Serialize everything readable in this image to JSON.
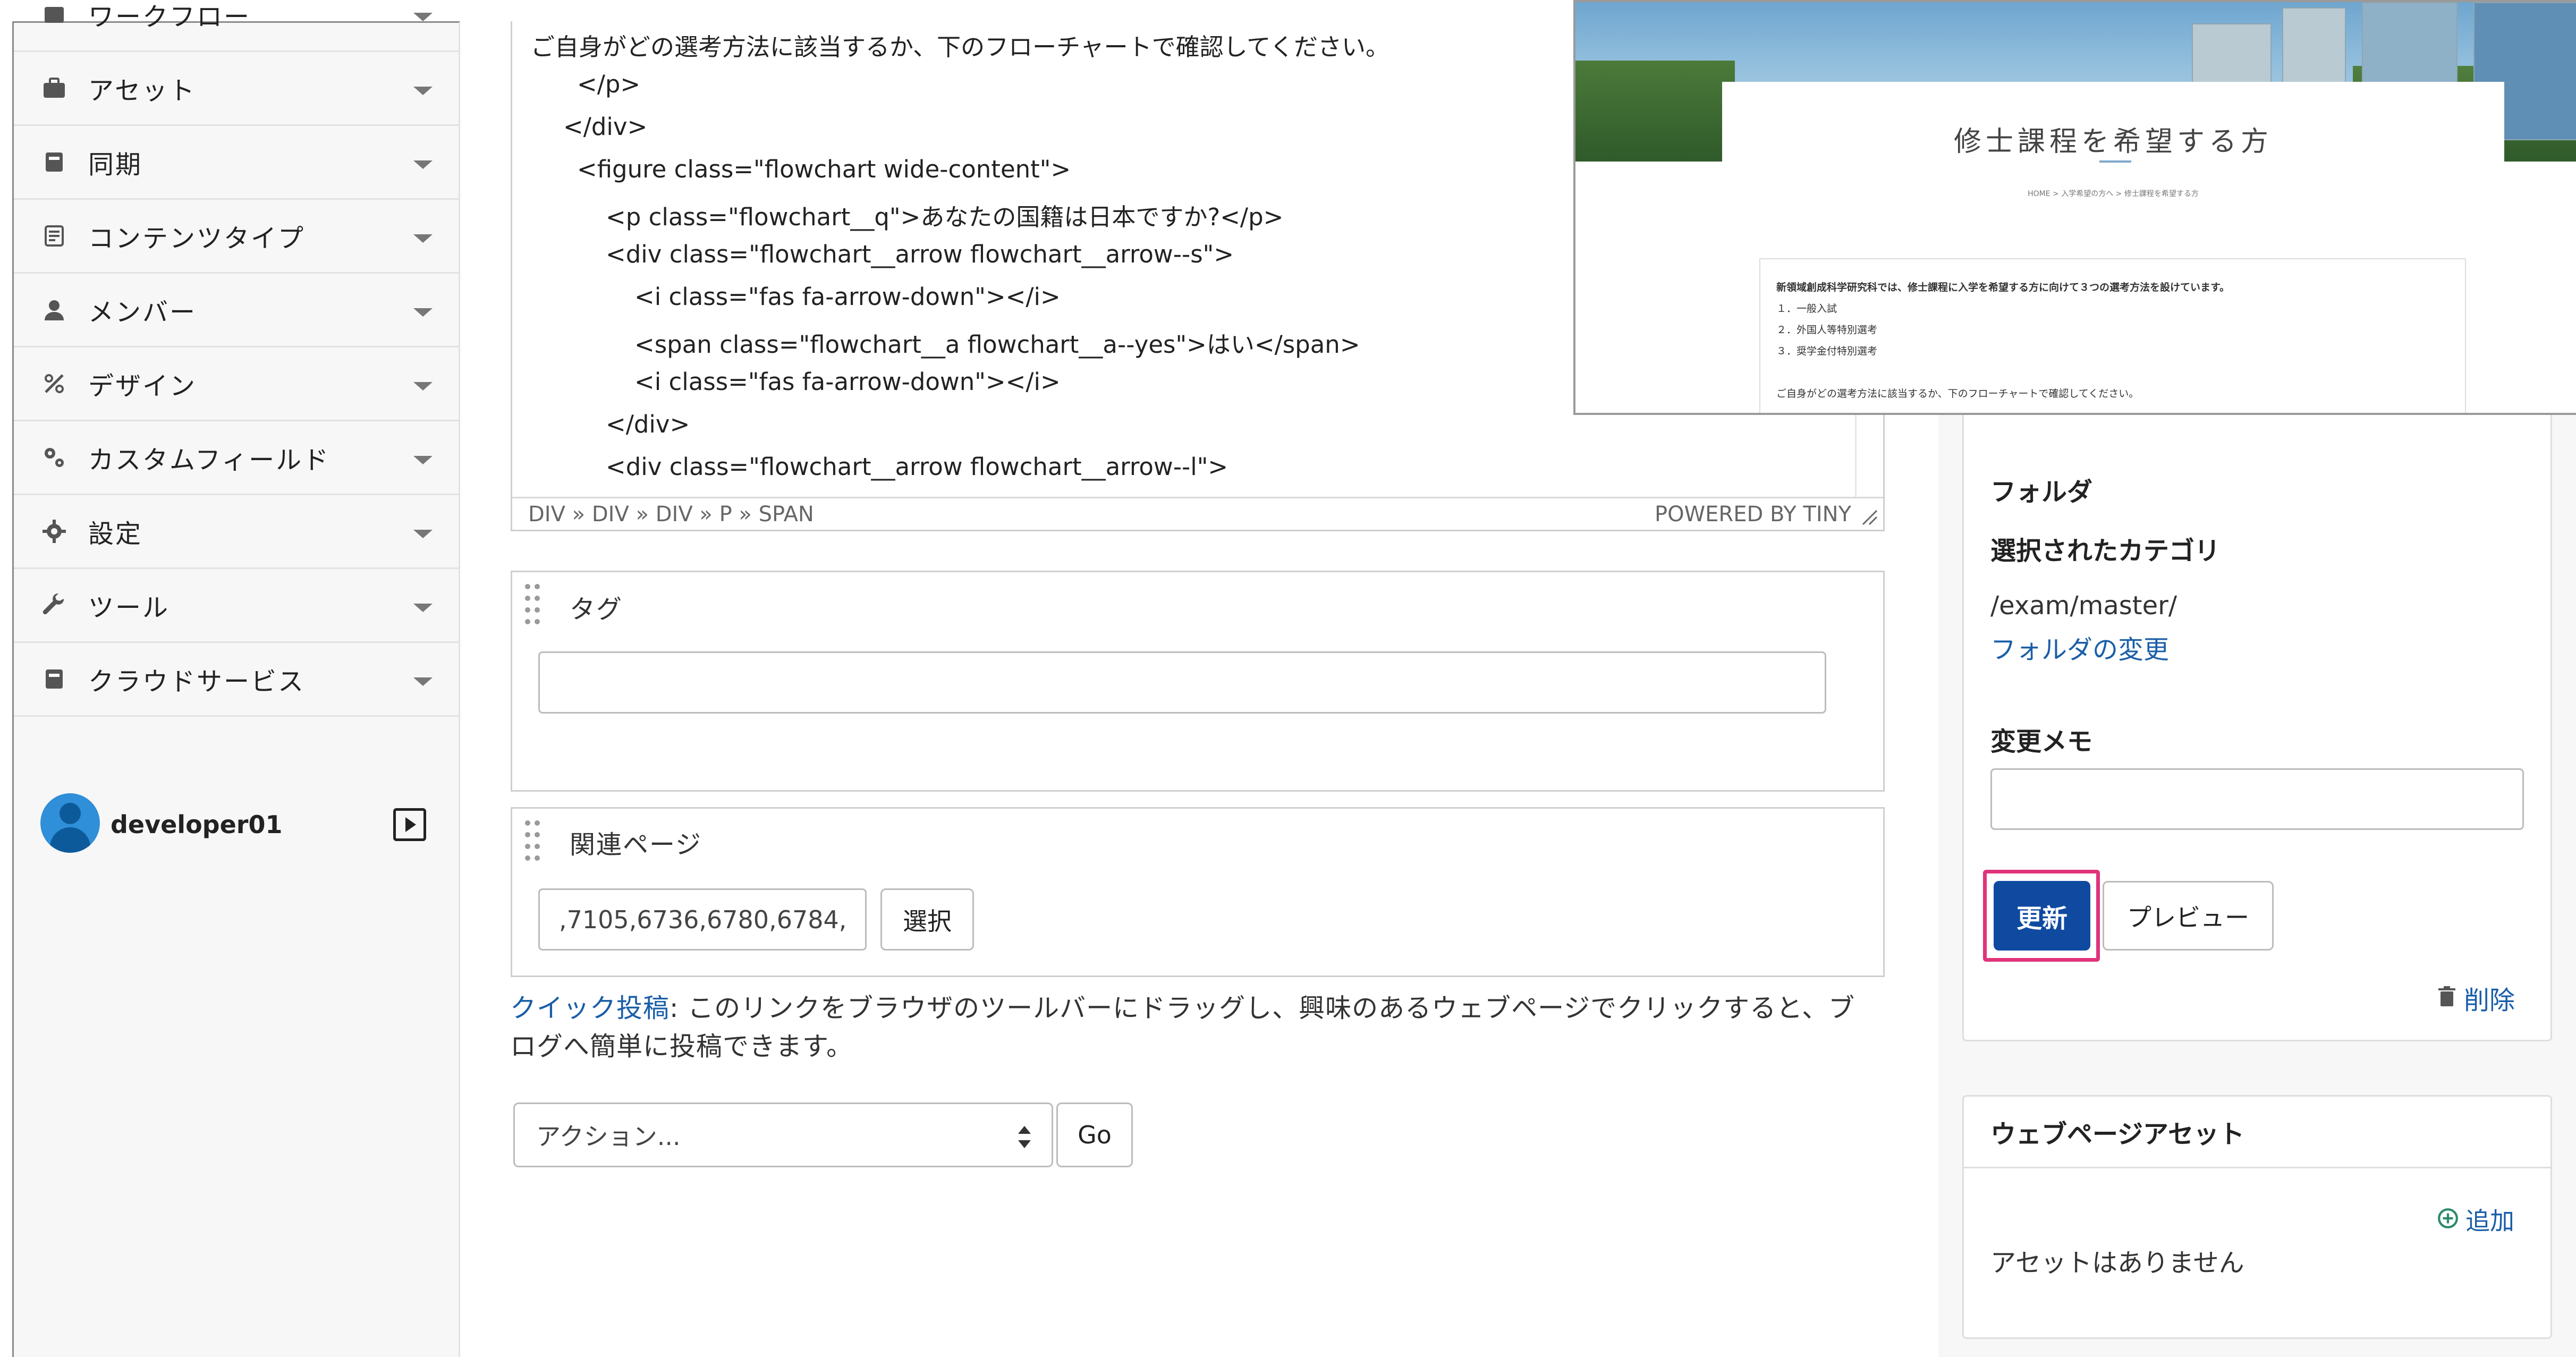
{
  "sidebar": {
    "items": [
      {
        "label": "ワークフロー",
        "icon": "workflow-icon"
      },
      {
        "label": "アセット",
        "icon": "briefcase-icon"
      },
      {
        "label": "同期",
        "icon": "sync-icon"
      },
      {
        "label": "コンテンツタイプ",
        "icon": "content-type-icon"
      },
      {
        "label": "メンバー",
        "icon": "user-icon"
      },
      {
        "label": "デザイン",
        "icon": "design-icon"
      },
      {
        "label": "カスタムフィールド",
        "icon": "custom-fields-icon"
      },
      {
        "label": "設定",
        "icon": "gear-icon"
      },
      {
        "label": "ツール",
        "icon": "wrench-icon"
      },
      {
        "label": "クラウドサービス",
        "icon": "cloud-service-icon"
      }
    ],
    "user": {
      "name": "developer01"
    }
  },
  "editor": {
    "lines": [
      "ご自身がどの選考方法に該当するか、下のフローチャートで確認してください。",
      "</p>",
      "</div>",
      "<figure class=\"flowchart wide-content\">",
      "<p class=\"flowchart__q\">あなたの国籍は日本ですか?</p>",
      "<div class=\"flowchart__arrow flowchart__arrow--s\">",
      "<i class=\"fas fa-arrow-down\"></i>",
      "<span class=\"flowchart__a flowchart__a--yes\">はい</span>",
      "<i class=\"fas fa-arrow-down\"></i>",
      "</div>",
      "<div class=\"flowchart__arrow flowchart__arrow--l\">"
    ],
    "path": "DIV » DIV » DIV » P » SPAN",
    "powered_by": "POWERED BY TINY"
  },
  "tags": {
    "title": "タグ",
    "value": ""
  },
  "related": {
    "title": "関連ページ",
    "value": ",7105,6736,6780,6784,",
    "select_label": "選択"
  },
  "quick_post": {
    "link": "クイック投稿",
    "text": ": このリンクをブラウザのツールバーにドラッグし、興味のあるウェブページでクリックすると、ブログへ簡単に投稿できます。"
  },
  "actions": {
    "select_value": "アクション...",
    "go_label": "Go"
  },
  "publish": {
    "folder_label": "フォルダ",
    "category_label": "選択されたカテゴリ",
    "folder_path": "/exam/master/",
    "change_folder": "フォルダの変更",
    "memo_label": "変更メモ",
    "memo_value": "",
    "update_label": "更新",
    "preview_label": "プレビュー",
    "delete_label": "削除",
    "highlight_color": "#e0347a",
    "primary_color": "#0f4aa0"
  },
  "assets": {
    "title": "ウェブページアセット",
    "add_label": "追加",
    "empty": "アセットはありません"
  },
  "preview": {
    "title": "修士課程を希望する方",
    "breadcrumb": "HOME  >  入学希望の方へ  >  修士課程を希望する方",
    "intro": "新領域創成科学研究科では、修士課程に入学を希望する方に向けて３つの選考方法を設けています。",
    "items": [
      "１．一般入試",
      "２．外国人等特別選考",
      "３．奨学金付特別選考"
    ],
    "outro": "ご自身がどの選考方法に該当するか、下のフローチャートで確認してください。"
  }
}
